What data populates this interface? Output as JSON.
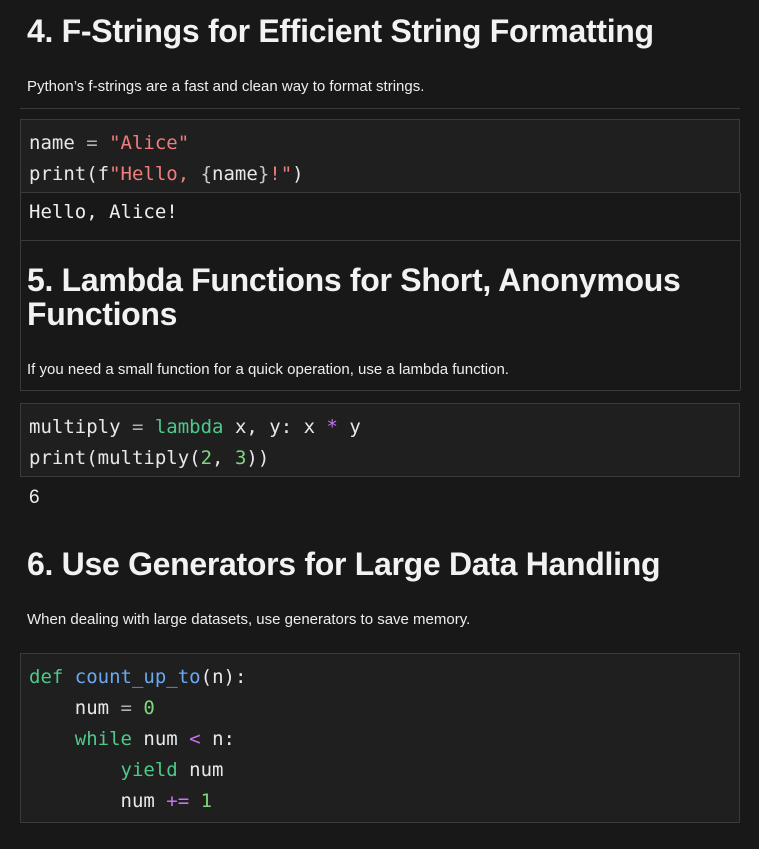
{
  "sections": [
    {
      "title": "4. F-Strings for Efficient String Formatting",
      "text": "Python’s f-strings are a fast and clean way to format strings.",
      "code": {
        "line1": {
          "a": "name ",
          "b": "=",
          "c": " ",
          "d": "\"Alice\""
        },
        "line2": {
          "a": "print(f",
          "b": "\"Hello, ",
          "c": "{",
          "d": "name",
          "e": "}",
          "f": "!\"",
          "g": ")"
        }
      },
      "output": "Hello, Alice!"
    },
    {
      "title_line1": "5. Lambda Functions for Short, Anonymous",
      "title_line2": "Functions",
      "text": "If you need a small function for a quick operation, use a lambda function.",
      "code": {
        "line1": {
          "a": "multiply ",
          "b": "=",
          "c": " ",
          "d": "lambda",
          "e": " x, y: x ",
          "f": "*",
          "g": " y"
        },
        "line2": {
          "a": "print(multiply(",
          "b": "2",
          "c": ", ",
          "d": "3",
          "e": "))"
        }
      },
      "output": "6"
    },
    {
      "title": "6. Use Generators for Large Data Handling",
      "text": "When dealing with large datasets, use generators to save memory.",
      "code": {
        "line1": {
          "a": "def",
          "b": " ",
          "c": "count_up_to",
          "d": "(n):"
        },
        "line2": {
          "a": "    num ",
          "b": "=",
          "c": " ",
          "d": "0"
        },
        "line3": {
          "a": "    ",
          "b": "while",
          "c": " num ",
          "d": "<",
          "e": " n:"
        },
        "line4": {
          "a": "        ",
          "b": "yield",
          "c": " num"
        },
        "line5": {
          "a": "        num ",
          "b": "+=",
          "c": " ",
          "d": "1"
        }
      }
    }
  ],
  "colors": {
    "background": "#181818",
    "code_background": "#1f1f1f",
    "string": "#f07d7d",
    "function": "#6aa9f2",
    "keyword": "#4ec98a",
    "number": "#7fd67f",
    "operator_purple": "#c774f0"
  }
}
